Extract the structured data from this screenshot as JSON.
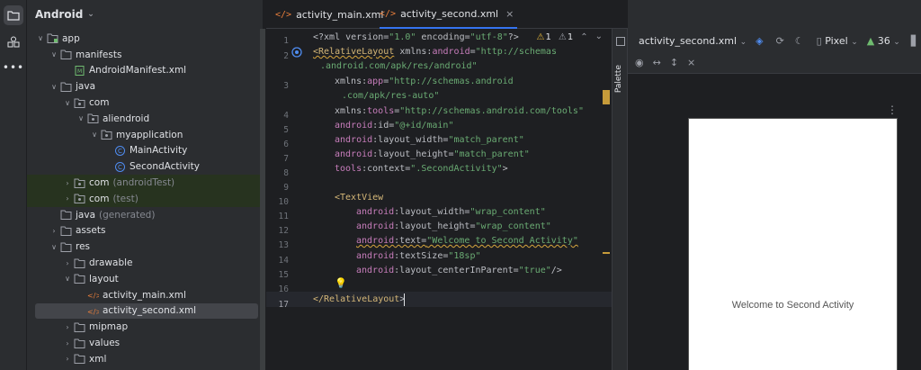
{
  "project": {
    "title": "Android",
    "tree": [
      {
        "label": "app",
        "kind": "module"
      },
      {
        "label": "manifests",
        "kind": "folder"
      },
      {
        "label": "AndroidManifest.xml",
        "kind": "manifest"
      },
      {
        "label": "java",
        "kind": "folder"
      },
      {
        "label": "com",
        "kind": "package"
      },
      {
        "label": "aliendroid",
        "kind": "package"
      },
      {
        "label": "myapplication",
        "kind": "package"
      },
      {
        "label": "MainActivity",
        "kind": "class"
      },
      {
        "label": "SecondActivity",
        "kind": "class"
      },
      {
        "label": "com",
        "suffix": "(androidTest)",
        "kind": "package"
      },
      {
        "label": "com",
        "suffix": "(test)",
        "kind": "package"
      },
      {
        "label": "java",
        "suffix": "(generated)",
        "kind": "folder"
      },
      {
        "label": "assets",
        "kind": "folder"
      },
      {
        "label": "res",
        "kind": "folder"
      },
      {
        "label": "drawable",
        "kind": "folder"
      },
      {
        "label": "layout",
        "kind": "folder"
      },
      {
        "label": "activity_main.xml",
        "kind": "xml"
      },
      {
        "label": "activity_second.xml",
        "kind": "xml"
      },
      {
        "label": "mipmap",
        "kind": "folder"
      },
      {
        "label": "values",
        "kind": "folder"
      },
      {
        "label": "xml",
        "kind": "folder"
      }
    ]
  },
  "tabs": [
    {
      "label": "activity_main.xml"
    },
    {
      "label": "activity_second.xml"
    }
  ],
  "inspections": {
    "warnings": "1",
    "weak": "1"
  },
  "code": {
    "line_numbers": [
      "1",
      "2",
      "",
      "3",
      "",
      "4",
      "5",
      "6",
      "7",
      "8",
      "9",
      "10",
      "11",
      "12",
      "13",
      "14",
      "15",
      "16",
      "17"
    ],
    "l1": {
      "a": "<?xml version=",
      "b": "\"1.0\"",
      "c": " encoding=",
      "d": "\"utf-8\"",
      "e": "?>"
    },
    "l2": {
      "tag": "<RelativeLayout",
      "ns": " xmlns:",
      "attr": "android",
      "eq": "=",
      "val": "\"http://schemas"
    },
    "l2b": ".android.com/apk/res/android\"",
    "l3": {
      "ns": "xmlns:",
      "attr": "app",
      "eq": "=",
      "val": "\"http://schemas.android"
    },
    "l3b": ".com/apk/res-auto\"",
    "l4": {
      "ns": "xmlns:",
      "attr": "tools",
      "eq": "=",
      "val": "\"http://schemas.android.com/tools\""
    },
    "l5": {
      "ns": "android",
      "attr": ":id=",
      "val": "\"@+id/main\""
    },
    "l6": {
      "ns": "android",
      "attr": ":layout_width=",
      "val": "\"match_parent\""
    },
    "l7": {
      "ns": "android",
      "attr": ":layout_height=",
      "val": "\"match_parent\""
    },
    "l8": {
      "ns": "tools",
      "attr": ":context=",
      "val": "\".SecondActivity\"",
      "end": ">"
    },
    "l10": {
      "tag": "<TextView"
    },
    "l11": {
      "ns": "android",
      "attr": ":layout_width=",
      "val": "\"wrap_content\""
    },
    "l12": {
      "ns": "android",
      "attr": ":layout_height=",
      "val": "\"wrap_content\""
    },
    "l13": {
      "ns": "android",
      "attr": ":text=",
      "val": "\"Welcome to Second Activity\""
    },
    "l14": {
      "ns": "android",
      "attr": ":textSize=",
      "val": "\"18sp\""
    },
    "l15": {
      "ns": "android",
      "attr": ":layout_centerInParent=",
      "val": "\"true\"",
      "end": "/>"
    },
    "l17": {
      "tag": "</RelativeLayout",
      "end": ">"
    }
  },
  "palette_label": "Palette",
  "design": {
    "file": "activity_second.xml",
    "device": "Pixel",
    "api": "36",
    "preview_text": "Welcome to Second Activity"
  }
}
